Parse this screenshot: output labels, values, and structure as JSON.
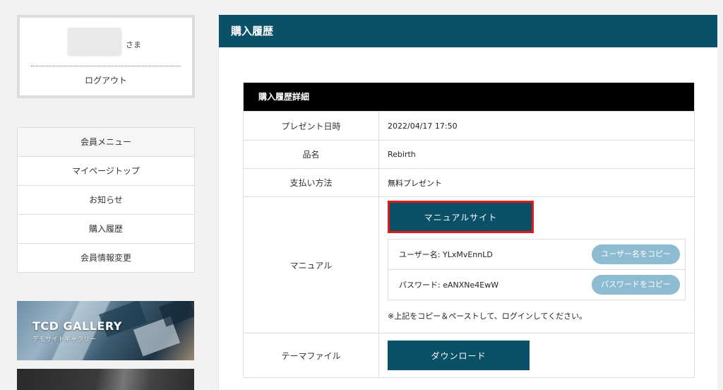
{
  "user": {
    "suffix": "さま",
    "logout": "ログアウト"
  },
  "menu": {
    "heading": "会員メニュー",
    "items": [
      "マイページトップ",
      "お知らせ",
      "購入履歴",
      "会員情報変更"
    ]
  },
  "banner": {
    "title": "TCD GALLERY",
    "subtitle": "デモサイトギャラリー"
  },
  "page": {
    "title": "購入履歴"
  },
  "details": {
    "heading": "購入履歴詳細",
    "present_label": "プレゼント日時",
    "present_value": "2022/04/17 17:50",
    "product_label": "品名",
    "product_value": "Rebirth",
    "payment_label": "支払い方法",
    "payment_value": "無料プレゼント",
    "manual_label": "マニュアル",
    "manual_button": "マニュアルサイト",
    "username_text": "ユーザー名: YLxMvEnnLD",
    "username_copy": "ユーザー名をコピー",
    "password_text": "パスワード: eANXNe4EwW",
    "password_copy": "パスワードをコピー",
    "note": "※上記をコピー＆ペーストして、ログインしてください。",
    "theme_label": "テーマファイル",
    "download_button": "ダウンロード"
  },
  "colors": {
    "accent": "#0a5067",
    "copy_pill": "#8dbbd1",
    "highlight": "#e11b1b"
  }
}
